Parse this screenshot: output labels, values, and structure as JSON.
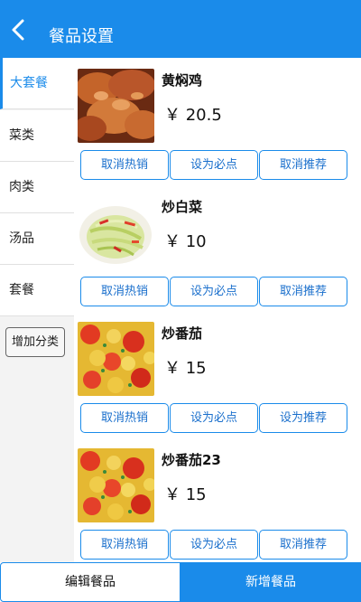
{
  "header": {
    "title": "餐品设置",
    "back_icon": "chevron-left-icon"
  },
  "sidebar": {
    "items": [
      {
        "label": "大套餐",
        "active": true
      },
      {
        "label": "菜类",
        "active": false
      },
      {
        "label": "肉类",
        "active": false
      },
      {
        "label": "汤品",
        "active": false
      },
      {
        "label": "套餐",
        "active": false
      }
    ],
    "add_label": "增加分类"
  },
  "dishes": [
    {
      "name": "黄焖鸡",
      "price": "￥ 20.5",
      "buttons": [
        "取消热销",
        "设为必点",
        "取消推荐"
      ]
    },
    {
      "name": "炒白菜",
      "price": "￥ 10",
      "buttons": [
        "取消热销",
        "设为必点",
        "取消推荐"
      ]
    },
    {
      "name": "炒番茄",
      "price": "￥ 15",
      "buttons": [
        "取消热销",
        "设为必点",
        "设为推荐"
      ]
    },
    {
      "name": "炒番茄23",
      "price": "￥ 15",
      "buttons": [
        "取消热销",
        "设为必点",
        "取消推荐"
      ]
    }
  ],
  "footer": {
    "edit_label": "编辑餐品",
    "add_label": "新增餐品"
  },
  "colors": {
    "accent": "#1a8bea",
    "button_text": "#1a6fcc"
  }
}
